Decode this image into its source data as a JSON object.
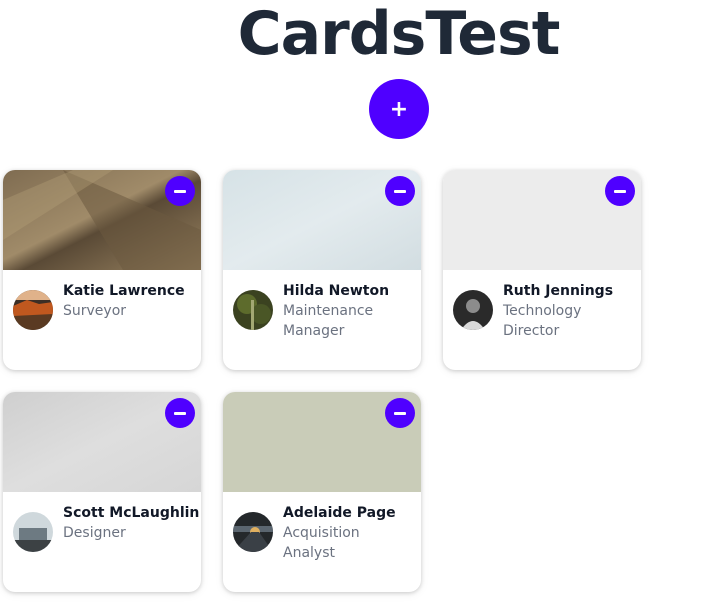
{
  "app": {
    "title": "CardsTest",
    "add_label": "+"
  },
  "cards": [
    {
      "name": "Katie Lawrence",
      "role": "Surveyor",
      "cover_colors": [
        "#7d6a50",
        "#a08d6c",
        "#4d3f2f"
      ],
      "avatar_colors": [
        "#c0581f",
        "#3c2f26",
        "#e09a4f"
      ]
    },
    {
      "name": "Hilda Newton",
      "role": "Maintenance Manager",
      "cover_colors": [
        "#d9e4e8",
        "#e4ecef",
        "#cfdbe0"
      ],
      "avatar_colors": [
        "#5d6b2c",
        "#3b4220",
        "#a3a873"
      ]
    },
    {
      "name": "Ruth Jennings",
      "role": "Technology Director",
      "cover_colors": [
        "#ececec",
        "#efefef",
        "#e6e6e6"
      ],
      "avatar_colors": [
        "#2a2a2a",
        "#8c8c8c",
        "#d9d9d9"
      ]
    },
    {
      "name": "Scott McLaughlin",
      "role": "Designer",
      "cover_colors": [
        "#d4d4d4",
        "#e0e0e0",
        "#c8c8c8"
      ],
      "avatar_colors": [
        "#6d7a82",
        "#cfd8dc",
        "#3c4144"
      ]
    },
    {
      "name": "Adelaide Page",
      "role": "Acquisition Analyst",
      "cover_colors": [
        "#c9ccb8",
        "#d3d5c3",
        "#bfc2ad"
      ],
      "avatar_colors": [
        "#24282b",
        "#e0b060",
        "#5b6670"
      ]
    }
  ],
  "accent_color": "#4f00ff"
}
